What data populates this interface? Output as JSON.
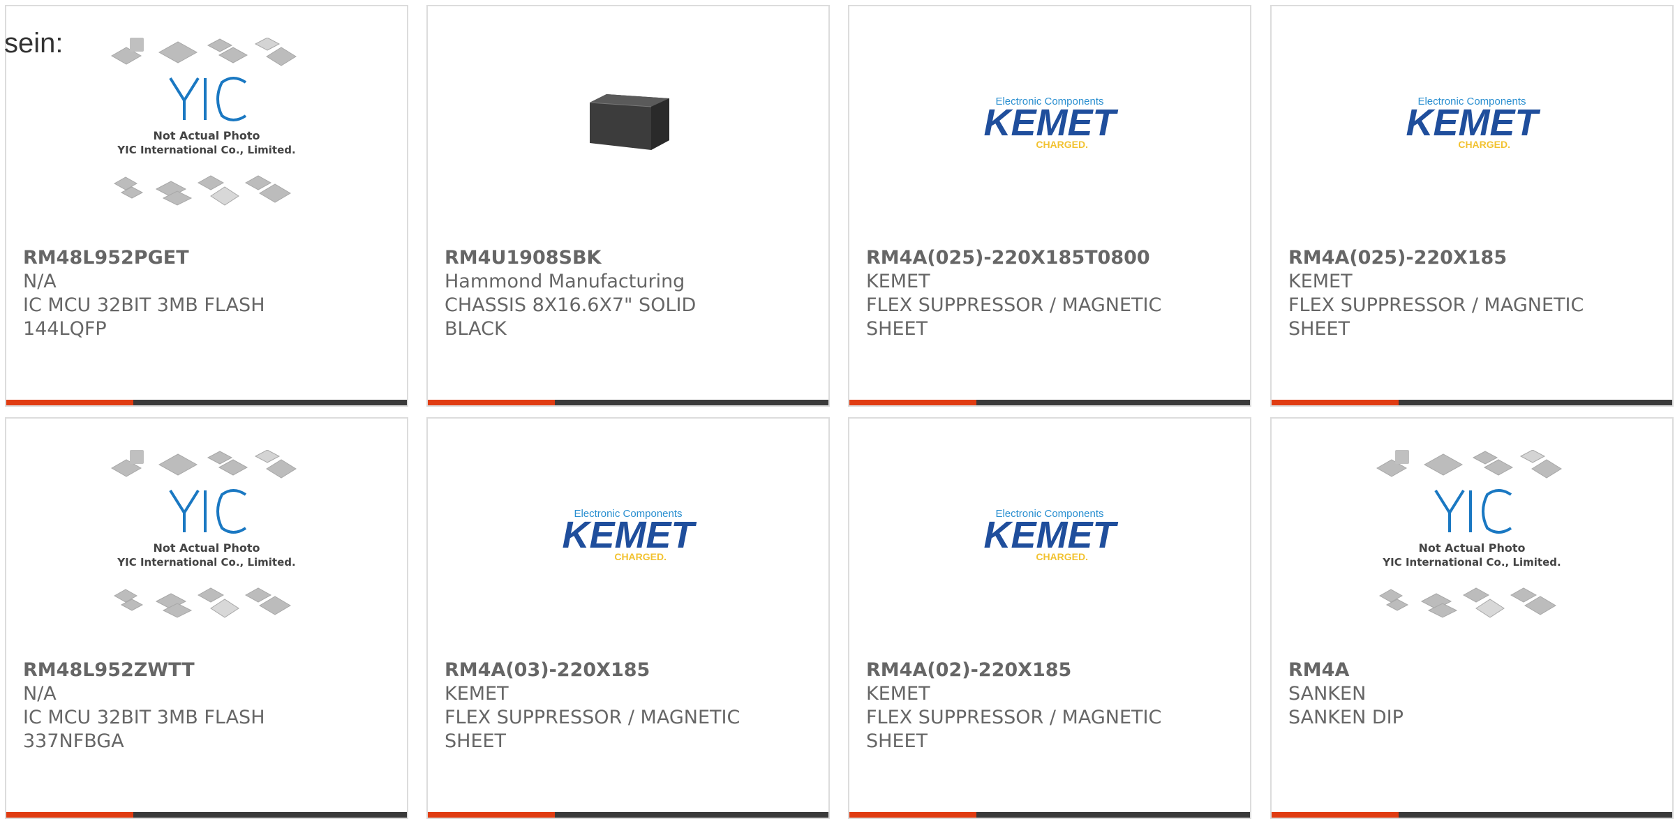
{
  "lead_text": "sein:",
  "colors": {
    "accent": "#e03c12",
    "bar_dark": "#3a3a3a",
    "kemet_blue": "#1f4e9c",
    "kemet_yellow": "#f2c230",
    "yic_blue": "#1a78c2"
  },
  "products": [
    {
      "part": "RM48L952PGET",
      "manufacturer": "N/A",
      "description": [
        "IC MCU 32BIT 3MB FLASH",
        "144LQFP"
      ],
      "image": {
        "type": "yic",
        "caption_line1": "Not Actual Photo",
        "caption_line2": "YIC International Co., Limited."
      }
    },
    {
      "part": "RM4U1908SBK",
      "manufacturer": "Hammond Manufacturing",
      "description": [
        "CHASSIS 8X16.6X7\" SOLID",
        "BLACK"
      ],
      "image": {
        "type": "chassis"
      }
    },
    {
      "part": "RM4A(025)-220X185T0800",
      "manufacturer": "KEMET",
      "description": [
        "FLEX SUPPRESSOR / MAGNETIC",
        "SHEET"
      ],
      "image": {
        "type": "kemet",
        "tagline": "Electronic Components",
        "wordmark": "KEMET",
        "sub": "CHARGED."
      }
    },
    {
      "part": "RM4A(025)-220X185",
      "manufacturer": "KEMET",
      "description": [
        "FLEX SUPPRESSOR / MAGNETIC",
        "SHEET"
      ],
      "image": {
        "type": "kemet",
        "tagline": "Electronic Components",
        "wordmark": "KEMET",
        "sub": "CHARGED."
      }
    },
    {
      "part": "RM48L952ZWTT",
      "manufacturer": "N/A",
      "description": [
        "IC MCU 32BIT 3MB FLASH",
        "337NFBGA"
      ],
      "image": {
        "type": "yic",
        "caption_line1": "Not Actual Photo",
        "caption_line2": "YIC International Co., Limited."
      }
    },
    {
      "part": "RM4A(03)-220X185",
      "manufacturer": "KEMET",
      "description": [
        "FLEX SUPPRESSOR / MAGNETIC",
        "SHEET"
      ],
      "image": {
        "type": "kemet",
        "tagline": "Electronic Components",
        "wordmark": "KEMET",
        "sub": "CHARGED."
      }
    },
    {
      "part": "RM4A(02)-220X185",
      "manufacturer": "KEMET",
      "description": [
        "FLEX SUPPRESSOR / MAGNETIC",
        "SHEET"
      ],
      "image": {
        "type": "kemet",
        "tagline": "Electronic Components",
        "wordmark": "KEMET",
        "sub": "CHARGED."
      }
    },
    {
      "part": "RM4A",
      "manufacturer": "SANKEN",
      "description": [
        "SANKEN DIP"
      ],
      "image": {
        "type": "yic",
        "caption_line1": "Not Actual Photo",
        "caption_line2": "YIC International Co., Limited."
      }
    }
  ]
}
